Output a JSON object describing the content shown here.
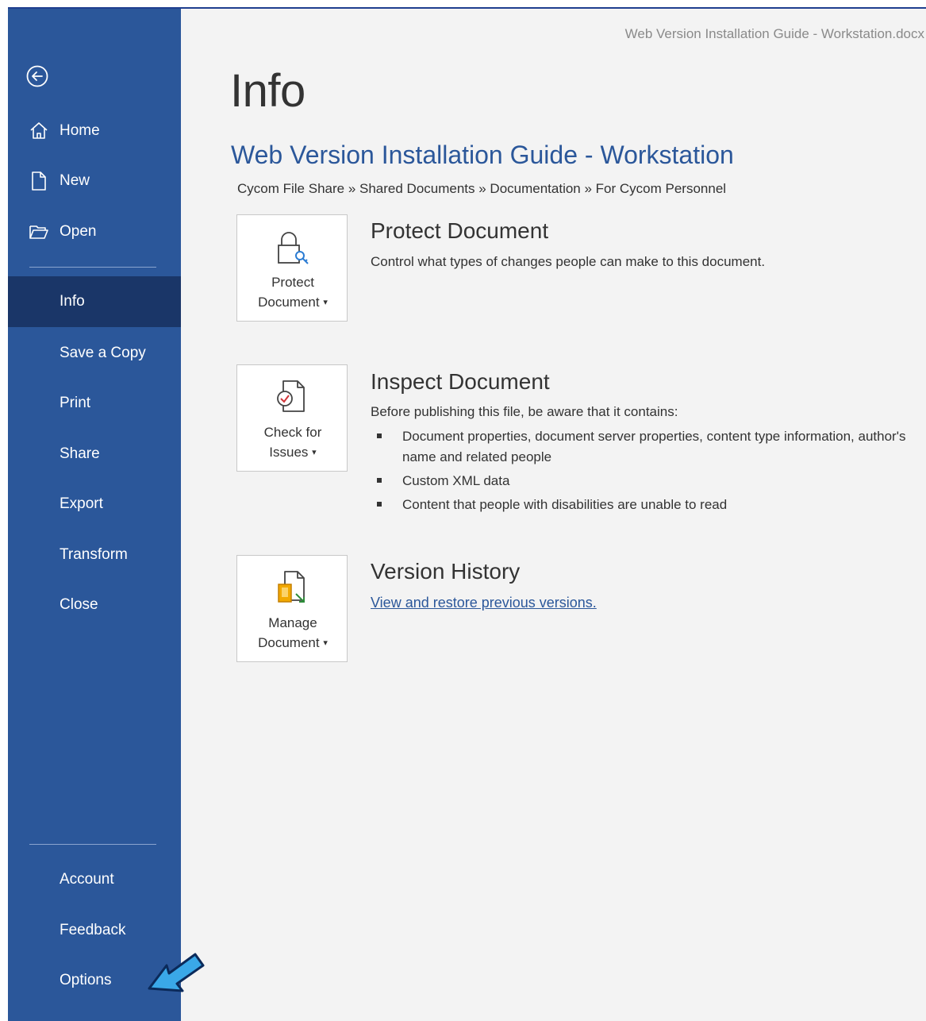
{
  "window": {
    "document_title": "Web Version Installation Guide - Workstation.docx"
  },
  "sidebar": {
    "back_icon": "back-arrow-circle-icon",
    "items": [
      {
        "label": "Home",
        "icon": "home-icon"
      },
      {
        "label": "New",
        "icon": "new-document-icon"
      },
      {
        "label": "Open",
        "icon": "open-folder-icon"
      },
      {
        "label": "Info",
        "active": true
      },
      {
        "label": "Save a Copy"
      },
      {
        "label": "Print"
      },
      {
        "label": "Share"
      },
      {
        "label": "Export"
      },
      {
        "label": "Transform"
      },
      {
        "label": "Close"
      },
      {
        "label": "Account"
      },
      {
        "label": "Feedback"
      },
      {
        "label": "Options"
      }
    ]
  },
  "main": {
    "page_title": "Info",
    "doc_name": "Web Version Installation Guide - Workstation",
    "breadcrumb": "Cycom File Share » Shared Documents » Documentation » For Cycom Personnel",
    "protect": {
      "tile_line1": "Protect",
      "tile_line2": "Document",
      "title": "Protect Document",
      "description": "Control what types of changes people can make to this document."
    },
    "inspect": {
      "tile_line1": "Check for",
      "tile_line2": "Issues",
      "title": "Inspect Document",
      "description": "Before publishing this file, be aware that it contains:",
      "bullets": [
        "Document properties, document server properties, content type information, author's name and related people",
        "Custom XML data",
        "Content that people with disabilities are unable to read"
      ]
    },
    "version": {
      "tile_line1": "Manage",
      "tile_line2": "Document",
      "title": "Version History",
      "link": "View and restore previous versions."
    }
  },
  "colors": {
    "sidebar": "#2b579a",
    "sidebar_active": "#1a3668",
    "accent": "#2b579a",
    "arrow": "#3aa8e8"
  }
}
